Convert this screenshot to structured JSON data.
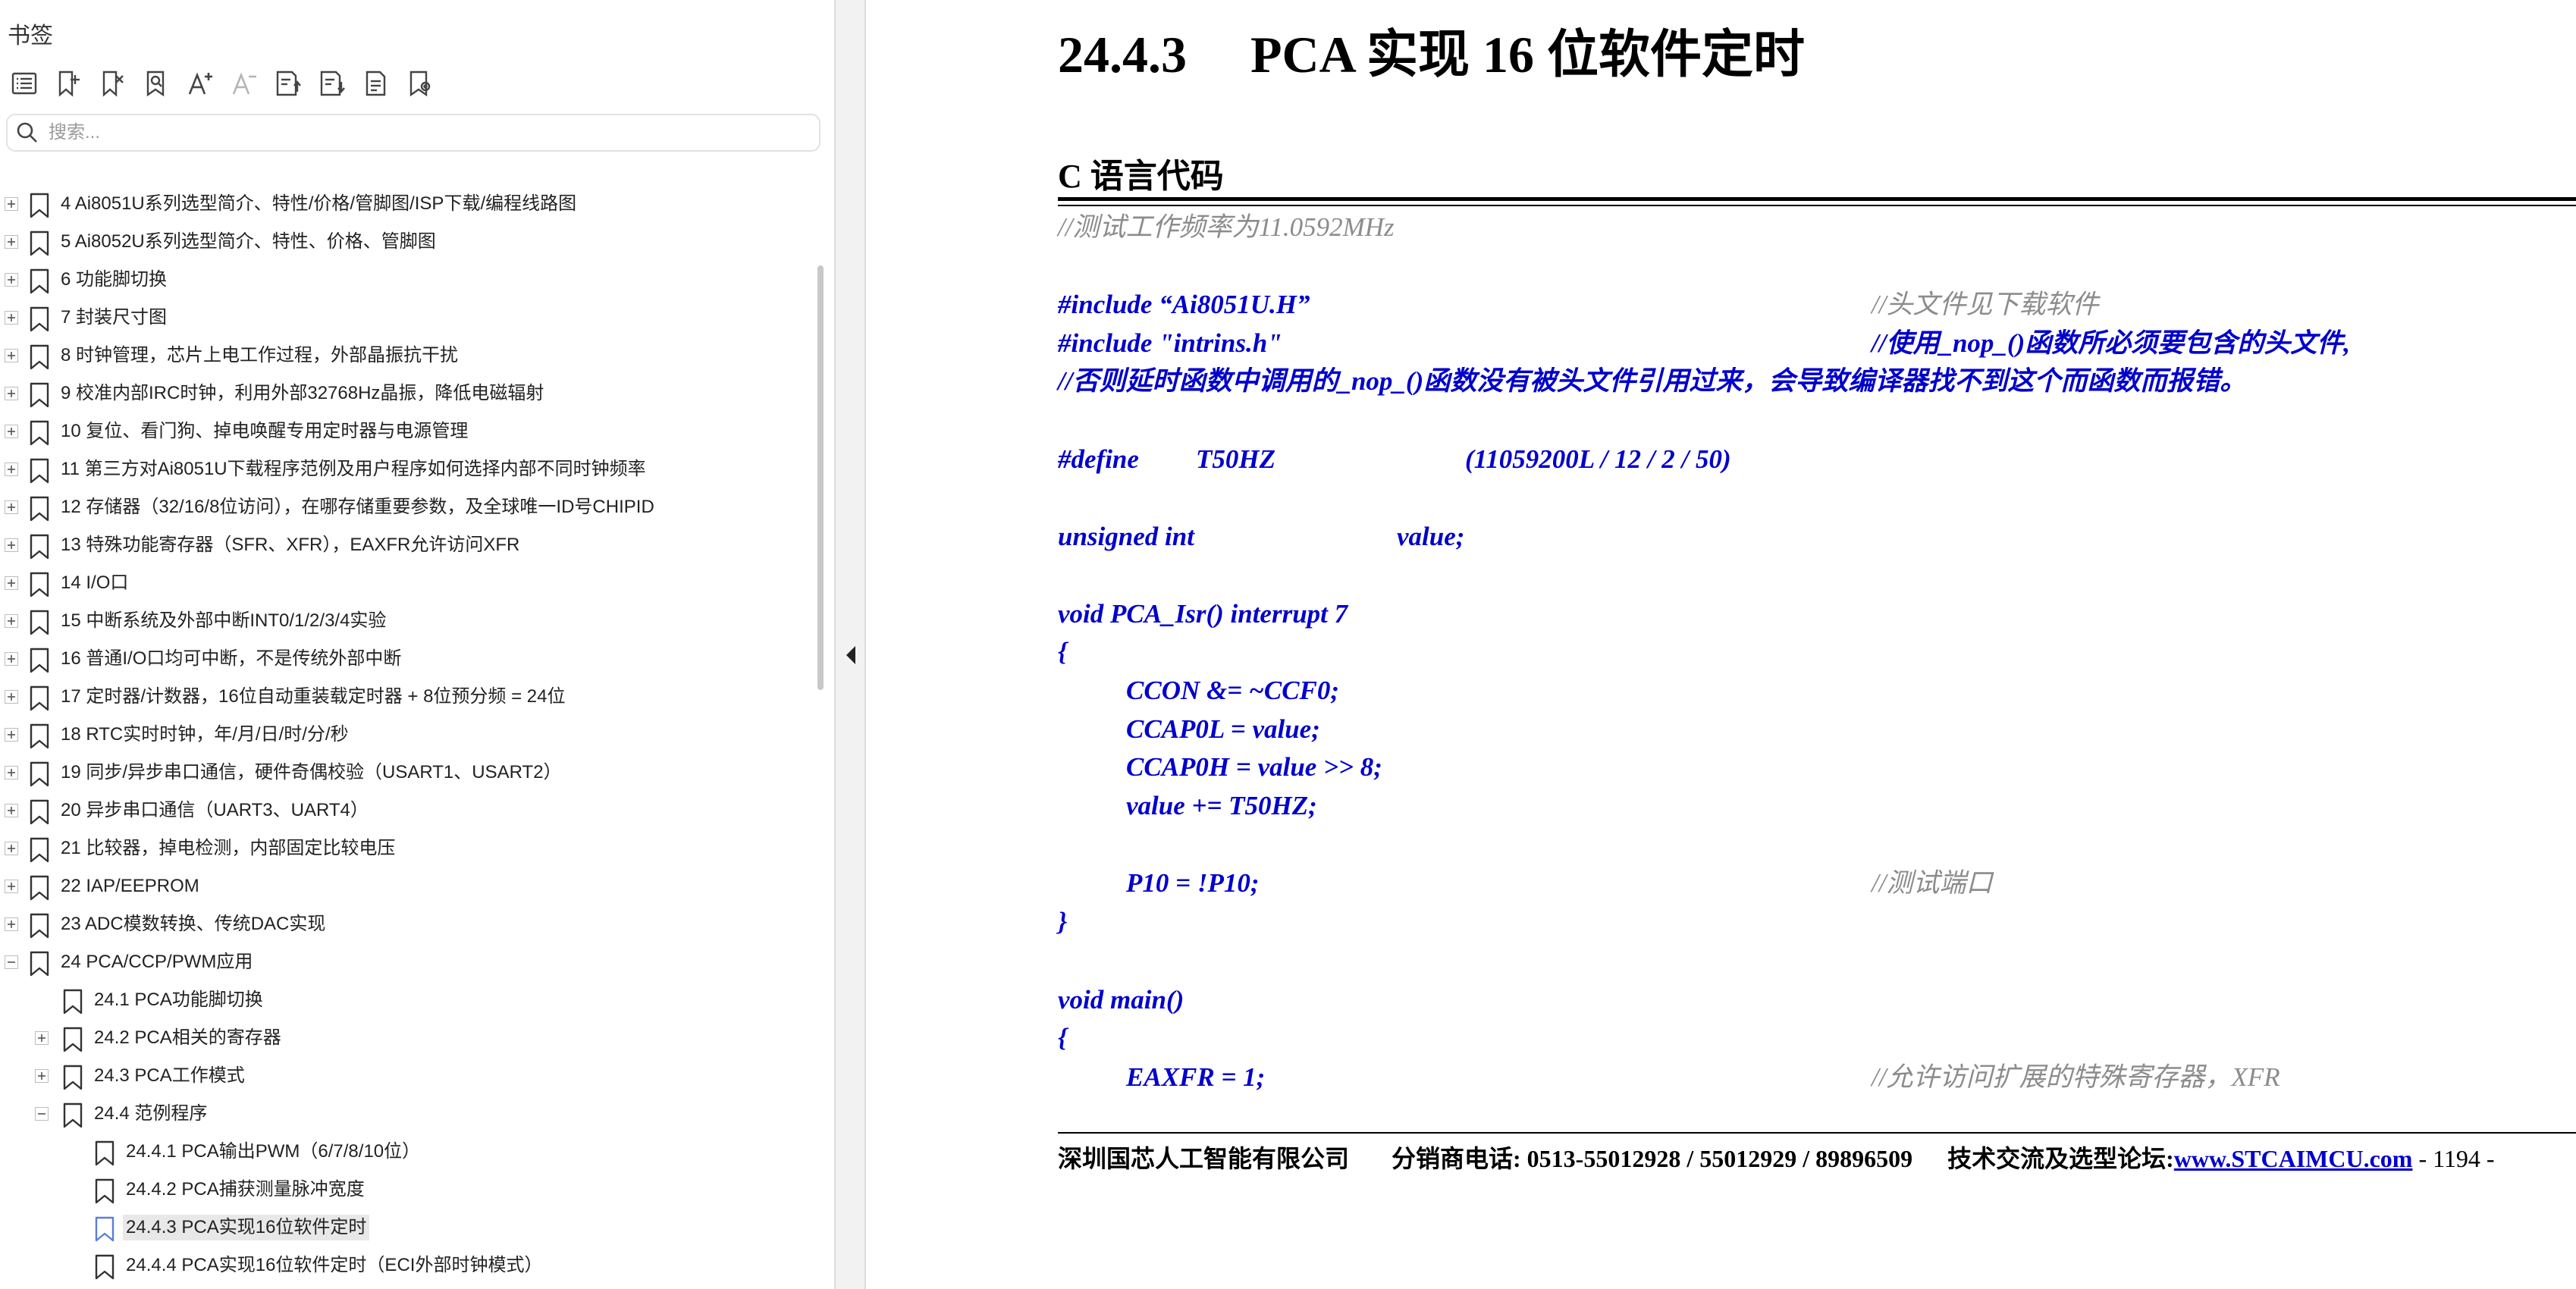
{
  "sidebar": {
    "title": "书签",
    "toolbar": [
      {
        "icon": "outline-list-icon"
      },
      {
        "icon": "add-bookmark-icon"
      },
      {
        "icon": "delete-bookmark-icon"
      },
      {
        "icon": "find-bookmark-icon"
      },
      {
        "icon": "increase-font-icon"
      },
      {
        "icon": "decrease-font-icon"
      },
      {
        "icon": "expand-all-icon"
      },
      {
        "icon": "collapse-all-icon"
      },
      {
        "icon": "export-icon"
      },
      {
        "icon": "settings-bookmark-icon"
      }
    ],
    "search_placeholder": "搜索...",
    "tree": [
      {
        "label": "4  Ai8051U系列选型简介、特性/价格/管脚图/ISP下载/编程线路图",
        "level": 0,
        "expander": "plus"
      },
      {
        "label": "5  Ai8052U系列选型简介、特性、价格、管脚图",
        "level": 0,
        "expander": "plus"
      },
      {
        "label": "6  功能脚切换",
        "level": 0,
        "expander": "plus"
      },
      {
        "label": "7  封装尺寸图",
        "level": 0,
        "expander": "plus"
      },
      {
        "label": "8  时钟管理，芯片上电工作过程，外部晶振抗干扰",
        "level": 0,
        "expander": "plus"
      },
      {
        "label": "9  校准内部IRC时钟，利用外部32768Hz晶振，降低电磁辐射",
        "level": 0,
        "expander": "plus"
      },
      {
        "label": "10  复位、看门狗、掉电唤醒专用定时器与电源管理",
        "level": 0,
        "expander": "plus"
      },
      {
        "label": "11  第三方对Ai8051U下载程序范例及用户程序如何选择内部不同时钟频率",
        "level": 0,
        "expander": "plus"
      },
      {
        "label": "12  存储器（32/16/8位访问），在哪存储重要参数，及全球唯一ID号CHIPID",
        "level": 0,
        "expander": "plus"
      },
      {
        "label": "13  特殊功能寄存器（SFR、XFR），EAXFR允许访问XFR",
        "level": 0,
        "expander": "plus"
      },
      {
        "label": "14  I/O口",
        "level": 0,
        "expander": "plus"
      },
      {
        "label": "15  中断系统及外部中断INT0/1/2/3/4实验",
        "level": 0,
        "expander": "plus"
      },
      {
        "label": "16  普通I/O口均可中断，不是传统外部中断",
        "level": 0,
        "expander": "plus"
      },
      {
        "label": "17  定时器/计数器，16位自动重装载定时器 + 8位预分频 = 24位",
        "level": 0,
        "expander": "plus"
      },
      {
        "label": "18  RTC实时时钟，年/月/日/时/分/秒",
        "level": 0,
        "expander": "plus"
      },
      {
        "label": "19  同步/异步串口通信，硬件奇偶校验（USART1、USART2）",
        "level": 0,
        "expander": "plus"
      },
      {
        "label": "20  异步串口通信（UART3、UART4）",
        "level": 0,
        "expander": "plus"
      },
      {
        "label": "21  比较器，掉电检测，内部固定比较电压",
        "level": 0,
        "expander": "plus"
      },
      {
        "label": "22  IAP/EEPROM",
        "level": 0,
        "expander": "plus"
      },
      {
        "label": "23  ADC模数转换、传统DAC实现",
        "level": 0,
        "expander": "plus"
      },
      {
        "label": "24  PCA/CCP/PWM应用",
        "level": 0,
        "expander": "minus"
      },
      {
        "label": "24.1 PCA功能脚切换",
        "level": 1,
        "expander": "none"
      },
      {
        "label": "24.2  PCA相关的寄存器",
        "level": 1,
        "expander": "plus"
      },
      {
        "label": "24.3  PCA工作模式",
        "level": 1,
        "expander": "plus"
      },
      {
        "label": "24.4  范例程序",
        "level": 1,
        "expander": "minus"
      },
      {
        "label": "24.4.1 PCA输出PWM（6/7/8/10位）",
        "level": 2,
        "expander": "none"
      },
      {
        "label": "24.4.2 PCA捕获测量脉冲宽度",
        "level": 2,
        "expander": "none"
      },
      {
        "label": "24.4.3 PCA实现16位软件定时",
        "level": 2,
        "expander": "none",
        "selected": true
      },
      {
        "label": "24.4.4 PCA实现16位软件定时（ECI外部时钟模式）",
        "level": 2,
        "expander": "none"
      }
    ]
  },
  "document": {
    "heading_number": "24.4.3",
    "heading_text": "PCA 实现 16 位软件定时",
    "section_title": "C 语言代码",
    "code": {
      "freq_comment": "//测试工作频率为11.0592MHz",
      "include1": "#include “Ai8051U.H”",
      "include1_comment": "//头文件见下载软件",
      "include2": "#include \"intrins.h\"",
      "include2_comment": "//使用_nop_()函数所必须要包含的头文件,",
      "include2_note": "//否则延时函数中调用的_nop_()函数没有被头文件引用过来，会导致编译器找不到这个而函数而报错。",
      "define_kw": "#define",
      "define_name": "T50HZ",
      "define_value": "(11059200L / 12 / 2 / 50)",
      "var_type": "unsigned int",
      "var_name": "value;",
      "isr_sig": "void PCA_Isr() interrupt 7",
      "open_brace": "{",
      "isr_line1": "CCON &= ~CCF0;",
      "isr_line2": "CCAP0L = value;",
      "isr_line3": "CCAP0H = value >> 8;",
      "isr_line4": "value += T50HZ;",
      "isr_line5": "P10 = !P10;",
      "isr_line5_comment": "//测试端口",
      "close_brace": "}",
      "main_sig": "void main()",
      "main_open_brace": "{",
      "main_line1": "EAXFR = 1;",
      "main_line1_comment": "//允许访问扩展的特殊寄存器，XFR"
    },
    "footer": {
      "company": "深圳国芯人工智能有限公司",
      "phone": "分销商电话: 0513-55012928 / 55012929 / 89896509",
      "forum_label": "技术交流及选型论坛:",
      "forum_link": "www.STCAIMCU.com",
      "page": "- 1194 -"
    }
  }
}
